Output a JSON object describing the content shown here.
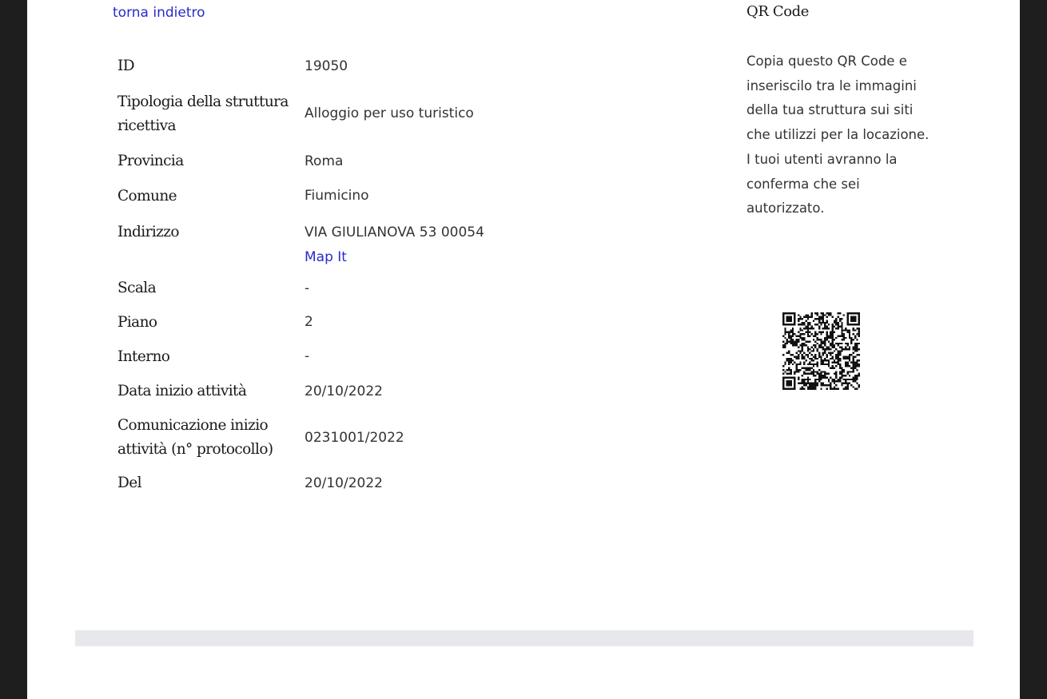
{
  "nav": {
    "back_link": "torna indietro"
  },
  "details": {
    "id": {
      "label": "ID",
      "value": "19050"
    },
    "tipologia": {
      "label": "Tipologia della struttura ricettiva",
      "value": "Alloggio per uso turistico"
    },
    "provincia": {
      "label": "Provincia",
      "value": "Roma"
    },
    "comune": {
      "label": "Comune",
      "value": "Fiumicino"
    },
    "indirizzo": {
      "label": "Indirizzo",
      "value": "VIA GIULIANOVA 53 00054",
      "map_link": "Map It"
    },
    "scala": {
      "label": "Scala",
      "value": "-"
    },
    "piano": {
      "label": "Piano",
      "value": "2"
    },
    "interno": {
      "label": "Interno",
      "value": "-"
    },
    "data_inizio": {
      "label": "Data inizio attività",
      "value": "20/10/2022"
    },
    "comunicazione": {
      "label": "Comunicazione inizio attività (n° protocollo)",
      "value": "0231001/2022"
    },
    "del": {
      "label": "Del",
      "value": "20/10/2022"
    }
  },
  "qr": {
    "title": "QR Code",
    "description": "Copia questo QR Code e inseriscilo tra le immagini della tua struttura sui siti che utilizzi per la locazione. I tuoi utenti avranno la conferma che sei autorizzato."
  },
  "colors": {
    "link": "#2a2acb",
    "page_background": "#1e1e1e",
    "footer_bar": "#e6e8eb"
  }
}
